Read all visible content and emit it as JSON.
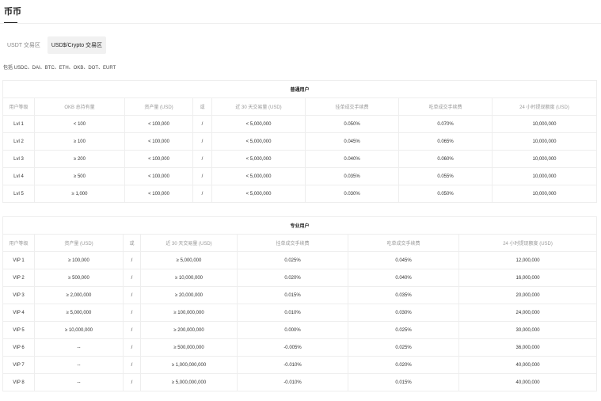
{
  "page_title": "币币",
  "tabs": [
    {
      "label": "USDT 交易区",
      "active": false
    },
    {
      "label": "USD$/Crypto 交易区",
      "active": true
    }
  ],
  "includes_note": "包括 USDC、DAI、BTC、ETH、OKB、DOT、EURT",
  "regular_table": {
    "title": "普通用户",
    "headers": [
      "用户等级",
      "OKB 总持有量",
      "资产量 (USD)",
      "或",
      "近 30 天交易量 (USD)",
      "挂单成交手续费",
      "吃单成交手续费",
      "24 小时提现额度 (USD)"
    ],
    "rows": [
      [
        "Lvl 1",
        "< 100",
        "< 100,000",
        "/",
        "< 5,000,000",
        "0.050%",
        "0.070%",
        "10,000,000"
      ],
      [
        "Lvl 2",
        "≥ 100",
        "< 100,000",
        "/",
        "< 5,000,000",
        "0.045%",
        "0.065%",
        "10,000,000"
      ],
      [
        "Lvl 3",
        "≥ 200",
        "< 100,000",
        "/",
        "< 5,000,000",
        "0.040%",
        "0.060%",
        "10,000,000"
      ],
      [
        "Lvl 4",
        "≥ 500",
        "< 100,000",
        "/",
        "< 5,000,000",
        "0.035%",
        "0.055%",
        "10,000,000"
      ],
      [
        "Lvl 5",
        "≥ 1,000",
        "< 100,000",
        "/",
        "< 5,000,000",
        "0.030%",
        "0.050%",
        "10,000,000"
      ]
    ]
  },
  "pro_table": {
    "title": "专业用户",
    "headers": [
      "用户等级",
      "资产量 (USD)",
      "或",
      "近 30 天交易量 (USD)",
      "挂单成交手续费",
      "吃单成交手续费",
      "24 小时提现额度 (USD)"
    ],
    "rows": [
      [
        "VIP 1",
        "≥ 100,000",
        "/",
        "≥ 5,000,000",
        "0.025%",
        "0.045%",
        "12,000,000"
      ],
      [
        "VIP 2",
        "≥ 500,000",
        "/",
        "≥ 10,000,000",
        "0.020%",
        "0.040%",
        "16,000,000"
      ],
      [
        "VIP 3",
        "≥ 2,000,000",
        "/",
        "≥ 20,000,000",
        "0.015%",
        "0.035%",
        "20,000,000"
      ],
      [
        "VIP 4",
        "≥ 5,000,000",
        "/",
        "≥ 100,000,000",
        "0.010%",
        "0.030%",
        "24,000,000"
      ],
      [
        "VIP 5",
        "≥ 10,000,000",
        "/",
        "≥ 200,000,000",
        "0.000%",
        "0.025%",
        "30,000,000"
      ],
      [
        "VIP 6",
        "--",
        "/",
        "≥ 500,000,000",
        "-0.005%",
        "0.025%",
        "36,000,000"
      ],
      [
        "VIP 7",
        "--",
        "/",
        "≥ 1,000,000,000",
        "-0.010%",
        "0.020%",
        "40,000,000"
      ],
      [
        "VIP 8",
        "--",
        "/",
        "≥ 5,000,000,000",
        "-0.010%",
        "0.015%",
        "40,000,000"
      ]
    ]
  }
}
